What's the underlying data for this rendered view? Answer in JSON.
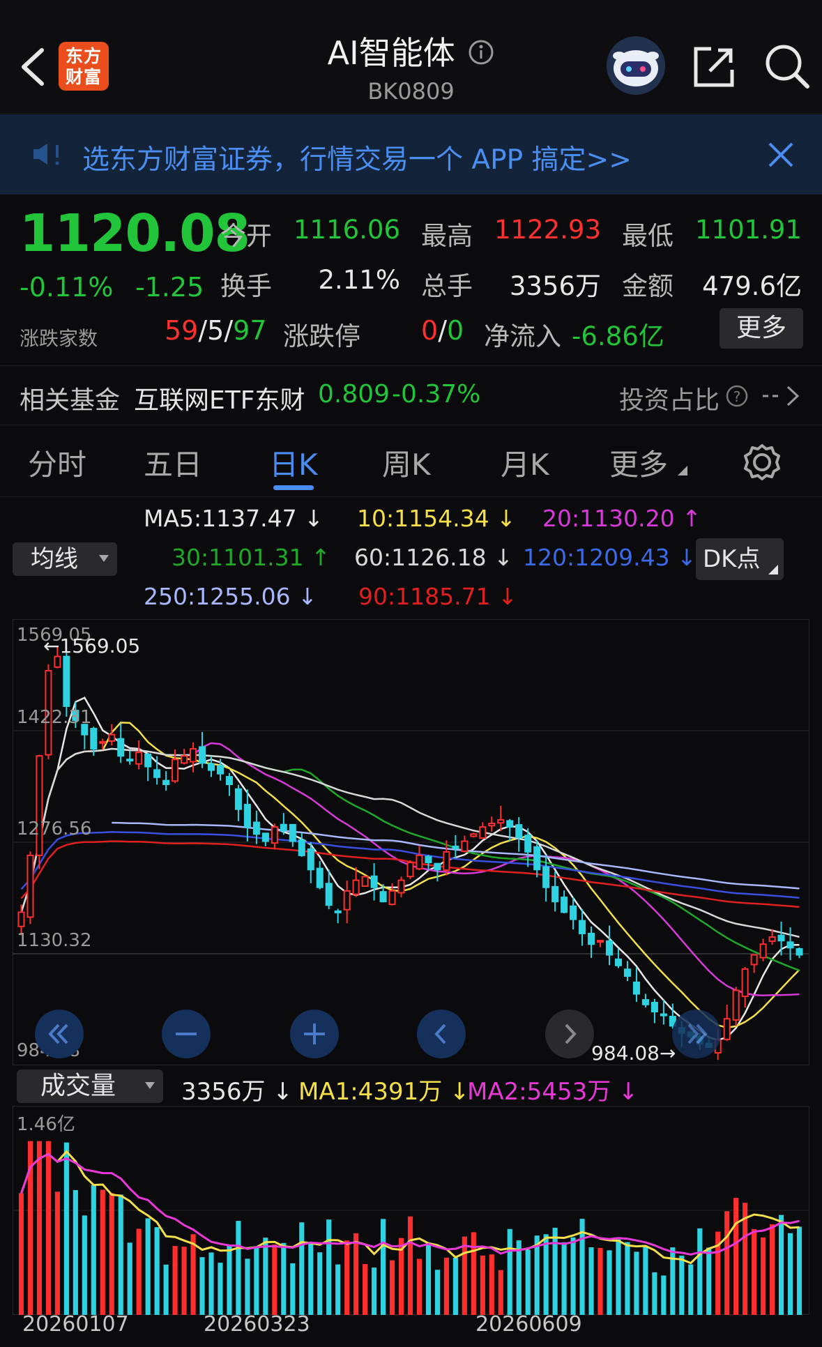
{
  "header": {
    "title": "AI智能体",
    "code": "BK0809",
    "logo_text": "东方财富"
  },
  "banner": {
    "text": "选东方财富证券，行情交易一个 APP 搞定>>"
  },
  "quote": {
    "price": "1120.08",
    "change_pct": "-0.11%",
    "change": "-1.25",
    "open_label": "今开",
    "open": "1116.06",
    "high_label": "最高",
    "high": "1122.93",
    "low_label": "最低",
    "low": "1101.91",
    "turnover_label": "换手",
    "turnover": "2.11%",
    "volume_label": "总手",
    "volume": "3356万",
    "amount_label": "金额",
    "amount": "479.6亿",
    "breadth_label": "涨跌家数",
    "breadth_up": "59",
    "breadth_flat": "5",
    "breadth_down": "97",
    "limit_label": "涨跌停",
    "limit_up": "0",
    "limit_down": "0",
    "netflow_label": "净流入",
    "netflow": "-6.86亿",
    "more_button": "更多"
  },
  "fund": {
    "label": "相关基金",
    "name": "互联网ETF东财",
    "price": "0.809",
    "change": "-0.37%",
    "ratio_label": "投资占比"
  },
  "tabs": [
    {
      "label": "分时"
    },
    {
      "label": "五日"
    },
    {
      "label": "日K"
    },
    {
      "label": "周K"
    },
    {
      "label": "月K"
    },
    {
      "label": "更多"
    }
  ],
  "indicators": {
    "selector": "均线",
    "ma5": "MA5:1137.47",
    "ma10": "10:1154.34",
    "ma20": "20:1130.20",
    "ma30": "30:1101.31",
    "ma60": "60:1126.18",
    "ma120": "120:1209.43",
    "ma250": "250:1255.06",
    "ma90": "90:1185.71",
    "dk_button": "DK点",
    "colors": {
      "ma5": "#e8e8e8",
      "ma10": "#f5e04a",
      "ma20": "#d83ad8",
      "ma30": "#1fa82a",
      "ma60": "#d9d9d9",
      "ma120": "#3a4fe0",
      "ma250": "#a9b8ff",
      "ma90": "#e02020"
    }
  },
  "price_axis": {
    "top": "1569.05",
    "high_marker": "←1569.05",
    "l2": "1422.31",
    "l3": "1276.56",
    "l4": "1130.32",
    "bottom": "984.08",
    "low_marker": "984.08→"
  },
  "volume": {
    "selector": "成交量",
    "value": "3356万",
    "ma1": "MA1:4391万",
    "ma2": "MA2:5453万",
    "axis_top": "1.46亿"
  },
  "dates": [
    "20260107",
    "20260323",
    "20260609"
  ],
  "chart_data": {
    "type": "candlestick",
    "title": "",
    "ylim": [
      984.08,
      1569.05
    ],
    "close": [
      1180,
      1260,
      1400,
      1520,
      1540,
      1470,
      1450,
      1430,
      1410,
      1420,
      1430,
      1400,
      1395,
      1405,
      1385,
      1370,
      1360,
      1395,
      1400,
      1410,
      1390,
      1380,
      1375,
      1360,
      1325,
      1300,
      1290,
      1280,
      1300,
      1295,
      1280,
      1260,
      1240,
      1215,
      1190,
      1180,
      1210,
      1225,
      1230,
      1215,
      1195,
      1210,
      1225,
      1250,
      1260,
      1250,
      1240,
      1265,
      1270,
      1280,
      1290,
      1300,
      1305,
      1310,
      1300,
      1285,
      1265,
      1240,
      1215,
      1195,
      1180,
      1170,
      1150,
      1135,
      1140,
      1120,
      1105,
      1090,
      1065,
      1050,
      1040,
      1035,
      1020,
      1010,
      1005,
      995,
      990,
      1000,
      1030,
      1070,
      1100,
      1120,
      1135,
      1145,
      1140,
      1130,
      1120
    ],
    "ma_values": {
      "MA5": 1137.47,
      "MA10": 1154.34,
      "MA20": 1130.2,
      "MA30": 1101.31,
      "MA60": 1126.18,
      "MA120": 1209.43,
      "MA250": 1255.06,
      "MA90": 1185.71
    },
    "volume_ylim": [
      0,
      1.46
    ],
    "volume_unit": "亿",
    "volume_ma": {
      "MA1": 4391,
      "MA2": 5453
    }
  }
}
